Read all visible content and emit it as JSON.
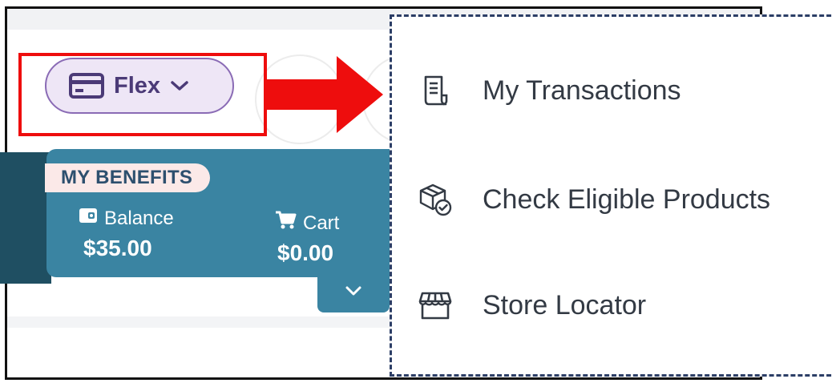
{
  "flex_selector": {
    "label": "Flex",
    "icon": "credit-card-icon",
    "chevron": "chevron-down-icon",
    "color": "#4b3a77",
    "background": "#eee6f6"
  },
  "benefits": {
    "badge": "MY BENEFITS",
    "balance_label": "Balance",
    "balance_icon": "wallet-icon",
    "balance_amount": "$35.00",
    "cart_label": "Cart",
    "cart_icon": "cart-icon",
    "cart_amount": "$0.00",
    "expand_icon": "chevron-down-icon",
    "color": "#3a84a2"
  },
  "annotation": {
    "highlight_color": "#ee0d0d",
    "arrow_icon": "arrow-right-icon",
    "menu_border_color": "#2c3e66"
  },
  "menu": {
    "items": [
      {
        "label": "My Transactions",
        "icon": "receipt-icon"
      },
      {
        "label": "Check Eligible Products",
        "icon": "package-check-icon"
      },
      {
        "label": "Store Locator",
        "icon": "storefront-icon"
      }
    ]
  }
}
